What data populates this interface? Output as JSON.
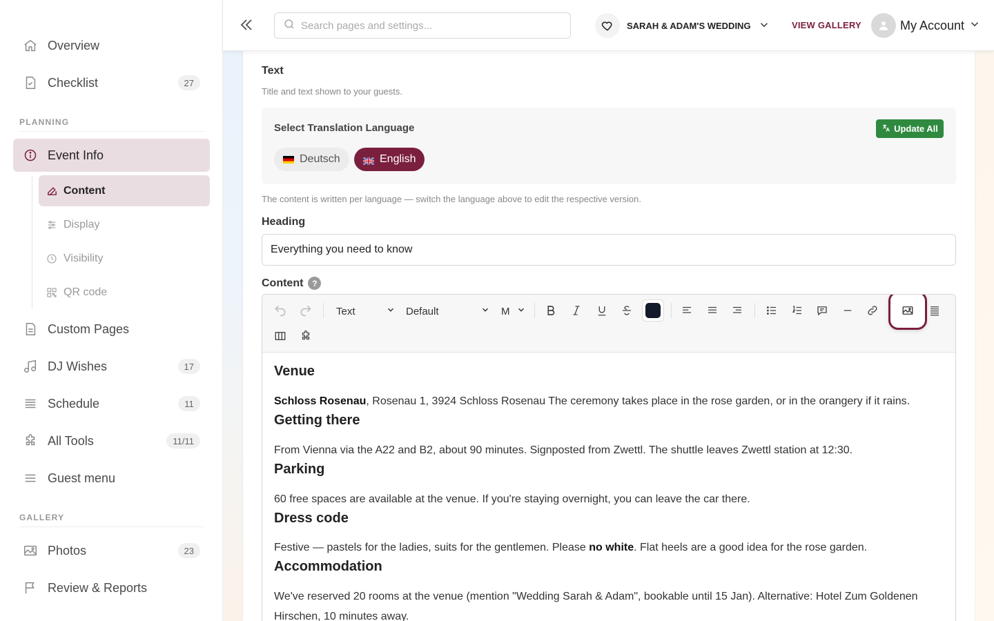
{
  "sidebar": {
    "items_top": [
      {
        "label": "Overview",
        "icon": "home-icon"
      },
      {
        "label": "Checklist",
        "icon": "checklist-icon",
        "badge": "27"
      }
    ],
    "planning_label": "PLANNING",
    "event_info": {
      "label": "Event Info",
      "icon": "info-icon"
    },
    "sub_items": [
      {
        "label": "Content",
        "icon": "edit-icon"
      },
      {
        "label": "Display",
        "icon": "sliders-icon"
      },
      {
        "label": "Visibility",
        "icon": "clock-icon"
      },
      {
        "label": "QR code",
        "icon": "qr-icon"
      }
    ],
    "items_planning": [
      {
        "label": "Custom Pages",
        "icon": "page-icon"
      },
      {
        "label": "DJ Wishes",
        "icon": "music-icon",
        "badge": "17"
      },
      {
        "label": "Schedule",
        "icon": "list-icon",
        "badge": "11"
      },
      {
        "label": "All Tools",
        "icon": "puzzle-icon",
        "badge": "11/11"
      },
      {
        "label": "Guest menu",
        "icon": "menu-icon"
      }
    ],
    "gallery_label": "GALLERY",
    "items_gallery": [
      {
        "label": "Photos",
        "icon": "image-icon",
        "badge": "23"
      },
      {
        "label": "Review & Reports",
        "icon": "flag-icon"
      }
    ]
  },
  "topbar": {
    "search_placeholder": "Search pages and settings...",
    "wedding": "SARAH & ADAM'S WEDDING",
    "view_gallery": "VIEW GALLERY",
    "account": "My Account"
  },
  "card": {
    "title": "Text",
    "subtitle": "Title and text shown to your guests.",
    "translation_title": "Select Translation Language",
    "update_all": "Update All",
    "languages": [
      {
        "label": "Deutsch",
        "selected": false
      },
      {
        "label": "English",
        "selected": true
      }
    ],
    "note": "The content is written per language — switch the language above to edit the respective version.",
    "heading_label": "Heading",
    "heading_value": "Everything you need to know",
    "content_label": "Content",
    "help": "?"
  },
  "toolbar": {
    "block_type": "Text",
    "font": "Default",
    "size": "M",
    "text_color": "#121a2b"
  },
  "content": {
    "venue_h": "Venue",
    "venue_bold": "Schloss Rosenau",
    "venue_text": ", Rosenau 1, 3924 Schloss Rosenau The ceremony takes place in the rose garden, or in the orangery if it rains.",
    "getting_h": "Getting there",
    "getting_text": "From Vienna via the A22 and B2, about 90 minutes. Signposted from Zwettl. The shuttle leaves Zwettl station at 12:30.",
    "parking_h": "Parking",
    "parking_text": "60 free spaces are available at the venue. If you're staying overnight, you can leave the car there.",
    "dress_h": "Dress code",
    "dress_pre": "Festive — pastels for the ladies, suits for the gentlemen. Please ",
    "dress_bold": "no white",
    "dress_post": ". Flat heels are a good idea for the rose garden.",
    "accom_h": "Accommodation",
    "accom_text": "We've reserved 20 rooms at the venue (mention \"Wedding Sarah & Adam\", bookable until 15 Jan). Alternative: Hotel Zum Goldenen Hirschen, 10 minutes away."
  },
  "colors": {
    "brand": "#7a1f3d",
    "active_bg": "#eadde2",
    "update_green": "#2f8a3f"
  }
}
